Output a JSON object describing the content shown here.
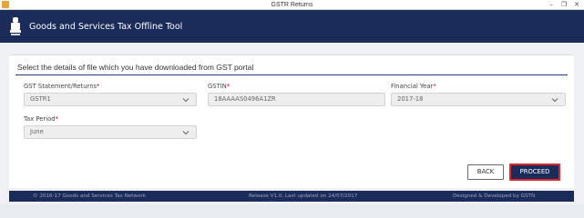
{
  "window": {
    "title": "GSTR Returns",
    "controls": {
      "minimize": "–",
      "maximize": "❐",
      "close": "✕"
    }
  },
  "header": {
    "brand": "Goods and Services Tax Offline Tool",
    "emblem_icon": "state-emblem-icon",
    "background": "#1b2c5a"
  },
  "form": {
    "subtitle": "Select the details of file which you have downloaded from GST portal",
    "fields": {
      "statement": {
        "label": "GST Statement/Returns",
        "required": "*",
        "value": "GSTR1"
      },
      "gstin": {
        "label": "GSTIN",
        "required": "*",
        "value": "18AAAAS0496A1ZR"
      },
      "year": {
        "label": "Financial Year",
        "required": "*",
        "value": "2017-18"
      },
      "period": {
        "label": "Tax Period",
        "required": "*",
        "value": "June"
      }
    }
  },
  "actions": {
    "back_label": "BACK",
    "proceed_label": "PROCEED",
    "accent": "#e0262d"
  },
  "footer": {
    "copyright": "© 2016-17 Goods and Services Tax Network",
    "release": "Release V1.0, Last updated on 24/07/2017",
    "credit": "Designed & Developed by GSTN"
  }
}
